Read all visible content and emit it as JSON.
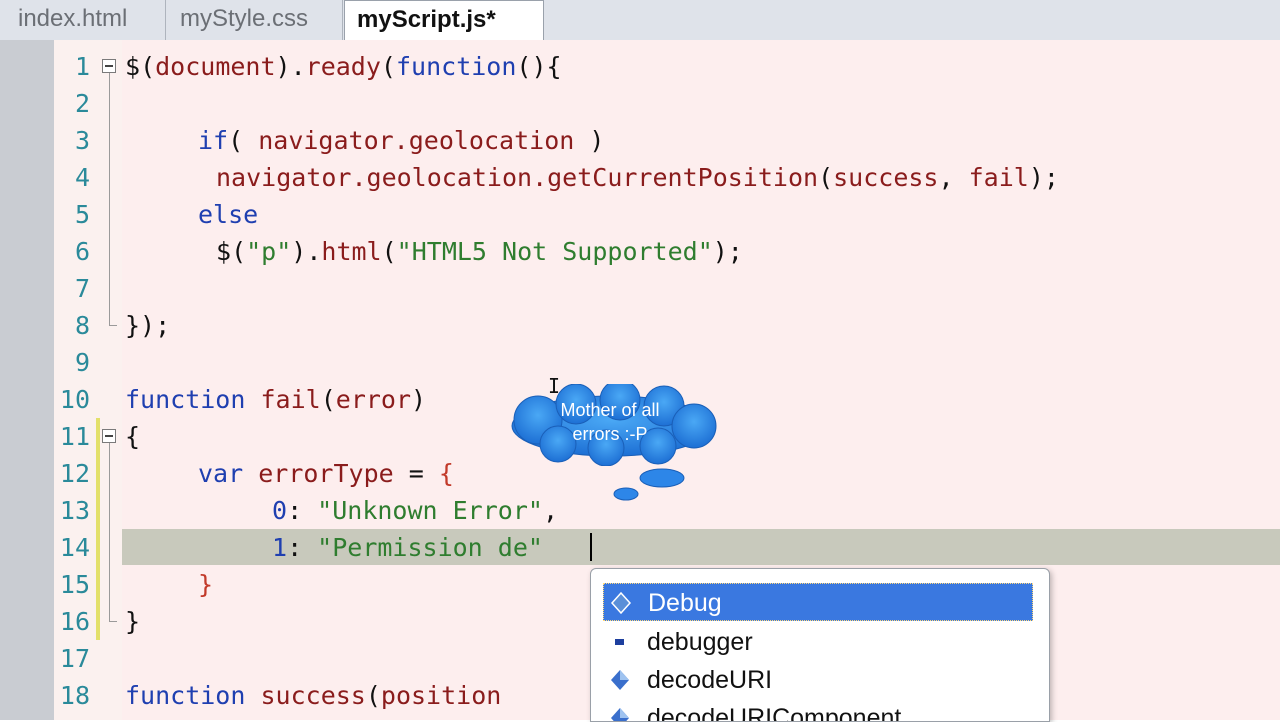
{
  "tabs": [
    {
      "label": "index.html",
      "active": false
    },
    {
      "label": "myStyle.css",
      "active": false
    },
    {
      "label": "myScript.js*",
      "active": true
    }
  ],
  "lines": [
    {
      "num": "1"
    },
    {
      "num": "2"
    },
    {
      "num": "3"
    },
    {
      "num": "4"
    },
    {
      "num": "5"
    },
    {
      "num": "6"
    },
    {
      "num": "7"
    },
    {
      "num": "8"
    },
    {
      "num": "9"
    },
    {
      "num": "10"
    },
    {
      "num": "11"
    },
    {
      "num": "12"
    },
    {
      "num": "13"
    },
    {
      "num": "14"
    },
    {
      "num": "15"
    },
    {
      "num": "16"
    },
    {
      "num": "17"
    },
    {
      "num": "18"
    }
  ],
  "code": {
    "l1": {
      "a": "$",
      "b": "(",
      "c": "document",
      "d": ").",
      "e": "ready",
      "f": "(",
      "g": "function",
      "h": "(){"
    },
    "l3": {
      "a": "if",
      "b": "( ",
      "c": "navigator.geolocation",
      "d": " )"
    },
    "l4": {
      "a": "navigator.geolocation.getCurrentPosition",
      "b": "(",
      "c": "success",
      "d": ", ",
      "e": "fail",
      "f": ");"
    },
    "l5": {
      "a": "else"
    },
    "l6": {
      "a": "$",
      "b": "(",
      "c": "\"p\"",
      "d": ").",
      "e": "html",
      "f": "(",
      "g": "\"HTML5 Not Supported\"",
      "h": ");"
    },
    "l8": {
      "a": "});"
    },
    "l10": {
      "a": "function",
      "b": " ",
      "c": "fail",
      "d": "(",
      "e": "error",
      "f": ")"
    },
    "l11": {
      "a": "{"
    },
    "l12": {
      "a": "var",
      "b": " ",
      "c": "errorType",
      "d": " = ",
      "e": "{"
    },
    "l13": {
      "a": "0",
      "b": ": ",
      "c": "\"Unknown Error\"",
      "d": ","
    },
    "l14": {
      "a": "1",
      "b": ": ",
      "c": "\"Permission de",
      "d": "\""
    },
    "l15": {
      "a": "}"
    },
    "l16": {
      "a": "}"
    },
    "l18": {
      "a": "function",
      "b": " ",
      "c": "success",
      "d": "(",
      "e": "position"
    }
  },
  "annotation": {
    "text_line1": "Mother of all",
    "text_line2": "errors :-P"
  },
  "autocomplete": {
    "items": [
      {
        "label": "Debug",
        "icon": "object-icon",
        "selected": true
      },
      {
        "label": "debugger",
        "icon": "keyword-icon",
        "selected": false
      },
      {
        "label": "decodeURI",
        "icon": "method-icon",
        "selected": false
      },
      {
        "label": "decodeURIComponent",
        "icon": "method-icon",
        "selected": false
      }
    ]
  },
  "colors": {
    "keyword": "#1f3fb0",
    "identifier": "#8a1c1c",
    "string": "#2f7d2f",
    "selection": "#3a78e0"
  }
}
